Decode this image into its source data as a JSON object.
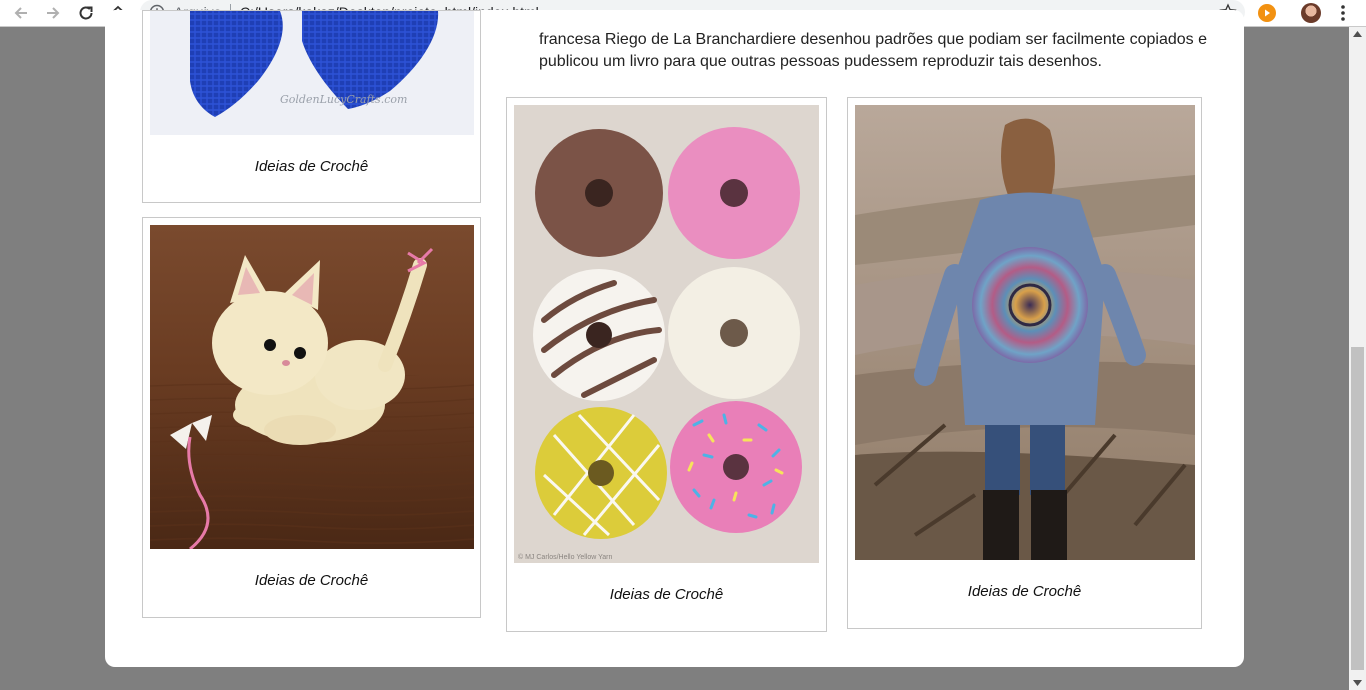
{
  "browser": {
    "scheme_label": "Arquivo",
    "url": "C:/Users/kakaz/Desktop/projeto_html/index.html"
  },
  "icons": {
    "back": "arrow-left-icon",
    "forward": "arrow-right-icon",
    "reload": "reload-icon",
    "home": "home-icon",
    "info": "info-icon",
    "bookmark": "star-icon",
    "extension": "play-extension-icon",
    "profile": "avatar",
    "menu": "kebab-menu-icon"
  },
  "colors": {
    "page_background": "#7f7f7f",
    "card": "#ffffff",
    "extension_accent": "#f29111"
  },
  "article": {
    "paragraph": "francesa Riego de La Branchardiere desenhou padrões que podiam ser facilmente copiados e publicou um livro para que outras pessoas pudessem reproduzir tais desenhos."
  },
  "gallery": [
    {
      "caption": "Ideias de Crochê",
      "watermark": "GoldenLucyCrafts.com"
    },
    {
      "caption": "Ideias de Crochê"
    },
    {
      "caption": "Ideias de Crochê",
      "watermark": "© MJ Carlos/Hello Yellow Yarn"
    },
    {
      "caption": "Ideias de Crochê"
    }
  ]
}
